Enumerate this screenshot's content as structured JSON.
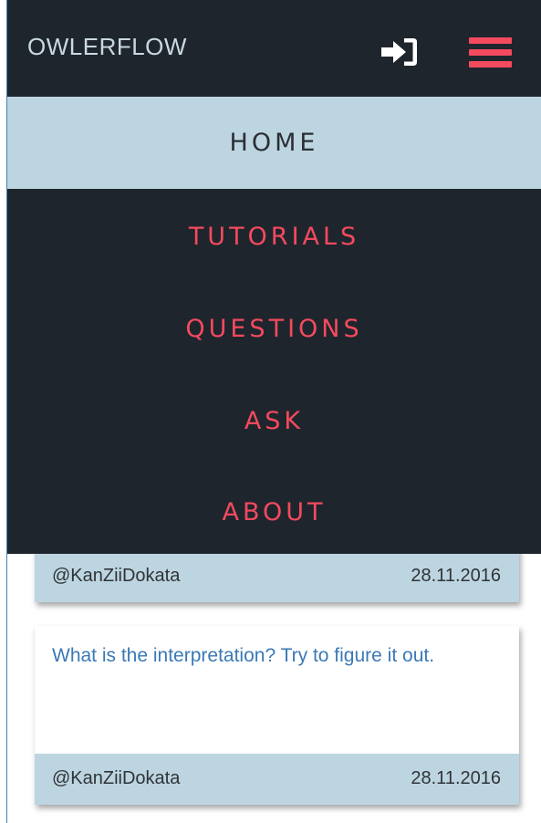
{
  "header": {
    "brand": "OWLERFLOW",
    "login_icon": "sign-in-icon",
    "menu_icon": "hamburger-menu-icon"
  },
  "nav": {
    "items": [
      {
        "label": "HOME",
        "active": true
      },
      {
        "label": "TUTORIALS",
        "active": false
      },
      {
        "label": "QUESTIONS",
        "active": false
      },
      {
        "label": "ASK",
        "active": false
      },
      {
        "label": "ABOUT",
        "active": false
      }
    ]
  },
  "posts": [
    {
      "title": "",
      "author": "@KanZiiDokata",
      "date": "28.11.2016"
    },
    {
      "title": "What is the interpretation? Try to figure it out.",
      "author": "@KanZiiDokata",
      "date": "28.11.2016"
    }
  ],
  "colors": {
    "navbar_bg": "#1f252d",
    "accent": "#f44a5e",
    "active_bg": "#bdd5e0",
    "link": "#3b79b6"
  }
}
